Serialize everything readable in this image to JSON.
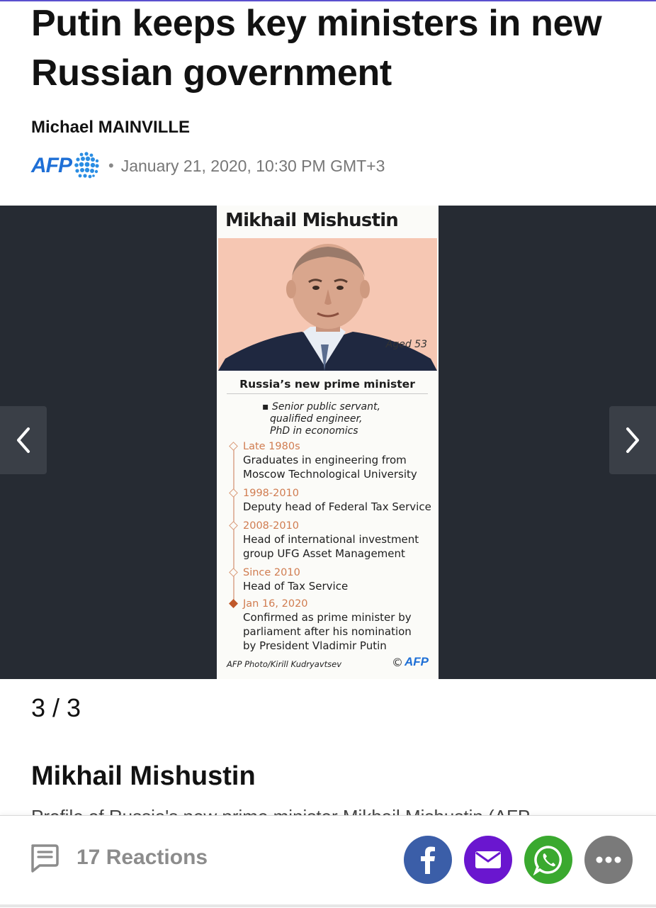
{
  "article": {
    "headline": "Putin keeps key ministers in new Russian government",
    "author": "Michael MAINVILLE",
    "source_logo_text": "AFP",
    "separator": "•",
    "date": "January 21, 2020, 10:30 PM GMT+3"
  },
  "gallery": {
    "counter": "3 / 3",
    "caption_title": "Mikhail Mishustin",
    "caption_text": "Profile of Russia's new prime minister Mikhail Mishustin (AFP",
    "graphic": {
      "title": "Mikhail Mishustin",
      "aged": "Aged 53",
      "subtitle": "Russia’s new prime minister",
      "bullet": [
        "Senior public servant,",
        "qualified engineer,",
        "PhD in economics"
      ],
      "events": [
        {
          "date": "Late 1980s",
          "lines": [
            "Graduates in engineering from",
            "Moscow Technological University"
          ]
        },
        {
          "date": "1998-2010",
          "lines": [
            "Deputy head of Federal Tax Service"
          ]
        },
        {
          "date": "2008-2010",
          "lines": [
            "Head of international investment",
            "group UFG Asset Management"
          ]
        },
        {
          "date": "Since 2010",
          "lines": [
            "Head of Tax Service"
          ]
        },
        {
          "date": "Jan 16, 2020",
          "lines": [
            "Confirmed as prime minister by",
            "parliament after his nomination",
            "by President Vladimir Putin"
          ]
        }
      ],
      "credit": "AFP Photo/Kirill Kudryavtsev",
      "copyright": "©",
      "copyright_logo": "AFP"
    }
  },
  "footer": {
    "reactions_label": "17 Reactions",
    "share_buttons": [
      {
        "name": "facebook",
        "icon": "facebook-icon",
        "color": "#3b5ea8"
      },
      {
        "name": "email",
        "icon": "mail-icon",
        "color": "#6a16cf"
      },
      {
        "name": "whatsapp",
        "icon": "whatsapp-icon",
        "color": "#3aa92f"
      },
      {
        "name": "more",
        "icon": "more-icon",
        "color": "#7a7a7a"
      }
    ]
  },
  "colors": {
    "accent_blue": "#1e6fd6",
    "gallery_bg": "#262b33",
    "timeline_orange": "#d07c50"
  }
}
